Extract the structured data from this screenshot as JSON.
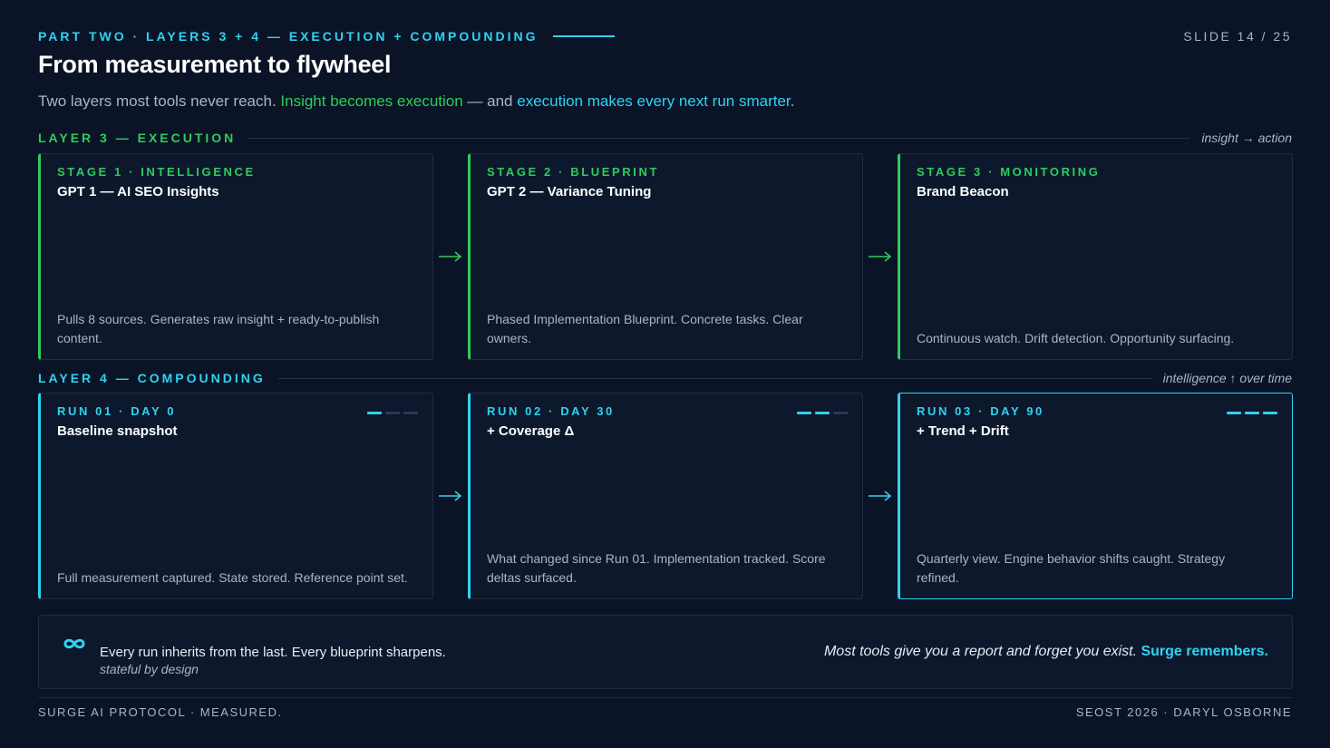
{
  "header": {
    "kicker": "PART TWO · LAYERS 3 + 4 — EXECUTION + COMPOUNDING",
    "slide_number": "SLIDE 14 / 25",
    "title": "From measurement to flywheel",
    "subtitle_start": "Two layers most tools never reach. ",
    "subtitle_green": "Insight becomes execution",
    "subtitle_mid": " — and ",
    "subtitle_cyan": "execution makes every next run smarter",
    "subtitle_end": "."
  },
  "layer3": {
    "label": "LAYER 3 — EXECUTION",
    "note": "insight → action",
    "cards": [
      {
        "stage": "STAGE 1 · INTELLIGENCE",
        "name": "GPT 1 — AI SEO Insights",
        "desc": "Pulls 8 sources. Generates raw insight + ready-to-publish content."
      },
      {
        "stage": "STAGE 2 · BLUEPRINT",
        "name": "GPT 2 — Variance Tuning",
        "desc": "Phased Implementation Blueprint. Concrete tasks. Clear owners."
      },
      {
        "stage": "STAGE 3 · MONITORING",
        "name": "Brand Beacon",
        "desc": "Continuous watch. Drift detection. Opportunity surfacing."
      }
    ]
  },
  "layer4": {
    "label": "LAYER 4 — COMPOUNDING",
    "note": "intelligence ↑ over time",
    "cards": [
      {
        "stage": "RUN 01 · DAY 0",
        "name": "Baseline snapshot",
        "desc": "Full measurement captured. State stored. Reference point set.",
        "progress": 1
      },
      {
        "stage": "RUN 02 · DAY 30",
        "name": "+ Coverage Δ",
        "desc": "What changed since Run 01. Implementation tracked. Score deltas surfaced.",
        "progress": 2
      },
      {
        "stage": "RUN 03 · DAY 90",
        "name": "+ Trend + Drift",
        "desc": "Quarterly view. Engine behavior shifts caught. Strategy refined.",
        "progress": 3
      }
    ]
  },
  "footer": {
    "icon": "infinity-icon",
    "main": "Every run inherits from the last. Every blueprint sharpens.",
    "sub": "stateful by design",
    "right_text": "Most tools give you a report and forget you exist. ",
    "right_bold": "Surge remembers."
  },
  "bottom": {
    "left": "SURGE AI PROTOCOL · MEASURED.",
    "right": "SEOST 2026 · DARYL OSBORNE"
  },
  "colors": {
    "background": "#0b1426",
    "green": "#2ecc5a",
    "cyan": "#2fd3f0",
    "card": "#0d182c",
    "muted": "#aab4c4"
  }
}
